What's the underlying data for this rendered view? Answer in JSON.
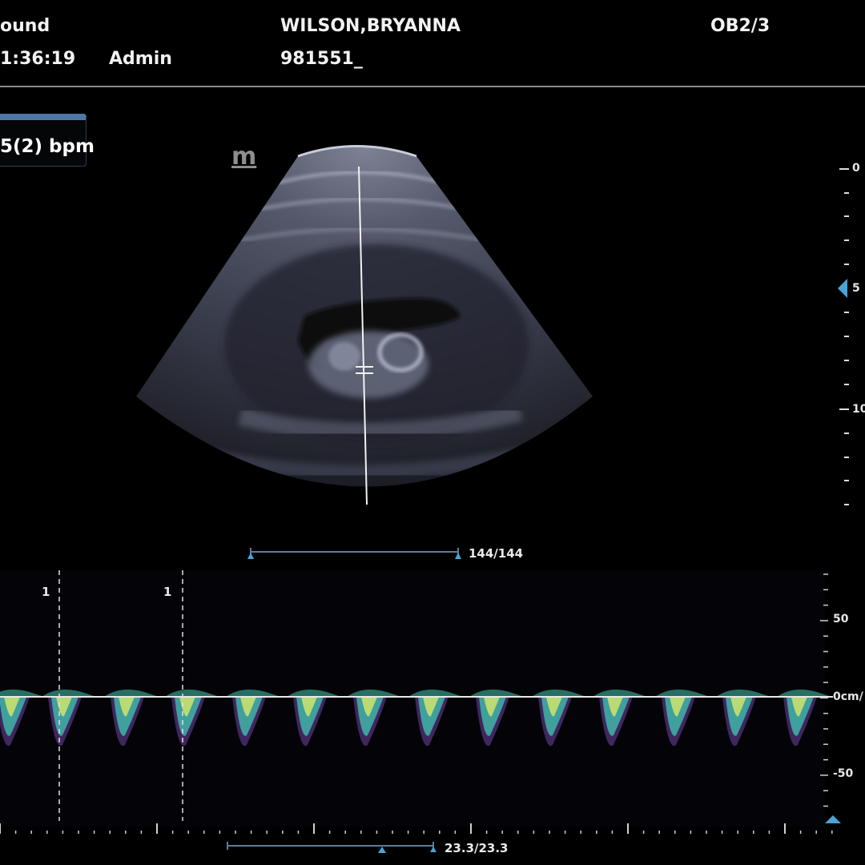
{
  "header": {
    "app_title": "ound",
    "time": "1:36:19",
    "operator": "Admin",
    "patient_name": "WILSON,BRYANNA",
    "patient_id": "981551_",
    "preset": "OB2/3"
  },
  "heart_rate": {
    "label": "5(2) bpm"
  },
  "bmode": {
    "logo": "m",
    "depth_scale": {
      "unit": "cm",
      "labels": [
        "0",
        "5",
        "10"
      ],
      "focus_marker_depth": 5
    },
    "frame_counter": "144/144"
  },
  "doppler": {
    "markers": [
      "1",
      "1"
    ],
    "velocity_scale": {
      "labels": [
        "50",
        "0cm/",
        "-50"
      ]
    },
    "sweep_counter": "23.3/23.3"
  },
  "colors": {
    "background": "#000000",
    "accent": "#4f78a8",
    "marker_blue": "#4aa3d8",
    "spectral_cyan": "#3fb6a8",
    "spectral_yellow": "#d9e86a"
  }
}
